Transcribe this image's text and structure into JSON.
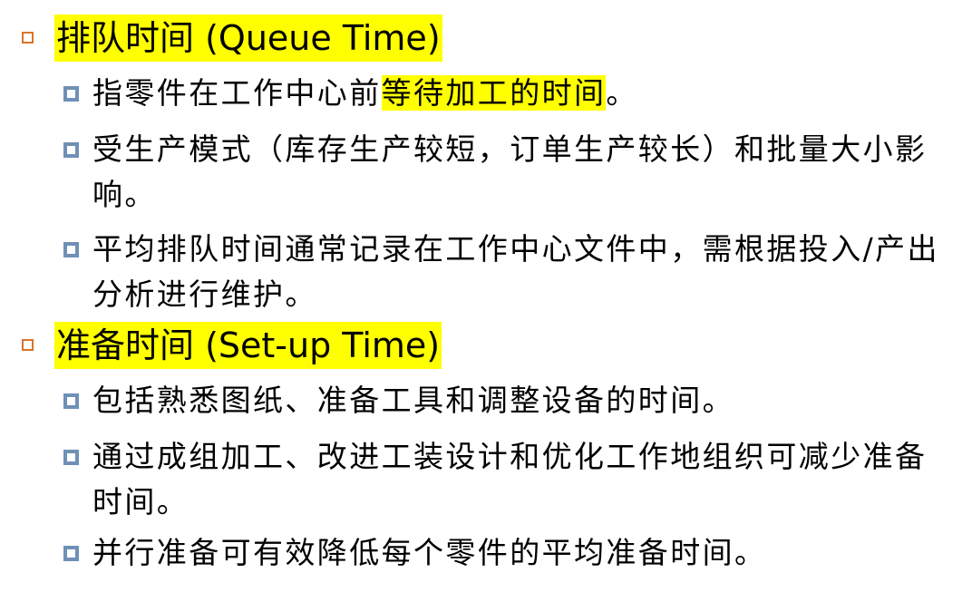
{
  "sections": [
    {
      "heading": "排队时间 (Queue Time)",
      "items": [
        {
          "before": "指零件在工作中心前",
          "highlight": "等待加工的时间",
          "after": "。"
        },
        {
          "before": "受生产模式（库存生产较短，订单生产较长）和批量大小影响。",
          "highlight": "",
          "after": ""
        },
        {
          "before": "平均排队时间通常记录在工作中心文件中，需根据投入/产出分析进行维护。",
          "highlight": "",
          "after": ""
        }
      ]
    },
    {
      "heading": "准备时间 (Set-up Time)",
      "items": [
        {
          "before": "包括熟悉图纸、准备工具和调整设备的时间。",
          "highlight": "",
          "after": ""
        },
        {
          "before": "通过成组加工、改进工装设计和优化工作地组织可减少准备时间。",
          "highlight": "",
          "after": ""
        },
        {
          "before": "并行准备可有效降低每个零件的平均准备时间。",
          "highlight": "",
          "after": ""
        }
      ]
    }
  ],
  "colors": {
    "highlight": "#ffff00",
    "level1_bullet": "#d8742a",
    "level2_bullet": "#6f90b6"
  },
  "icons": {
    "level1": "hollow-square-bullet-icon",
    "level2": "filled-square-bullet-icon"
  }
}
